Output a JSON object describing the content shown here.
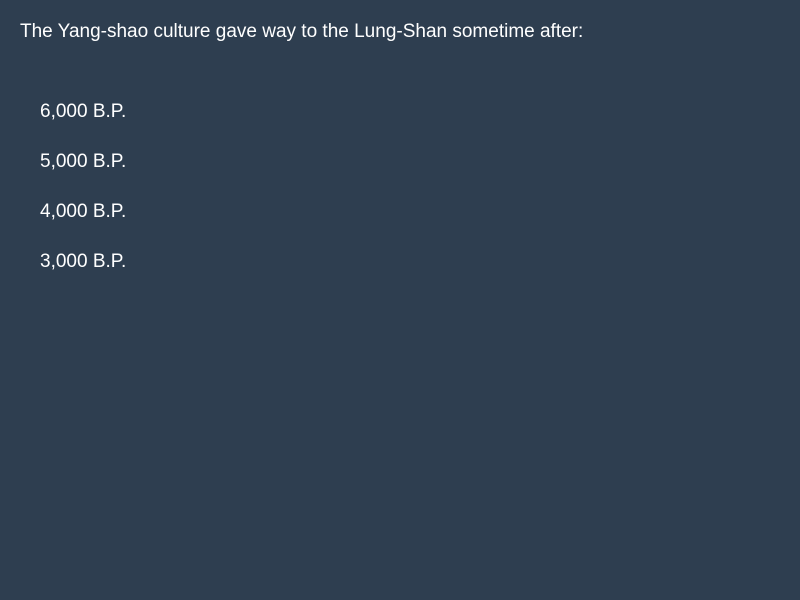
{
  "question": {
    "text": "The Yang-shao culture gave way to the Lung-Shan sometime after:"
  },
  "options": [
    {
      "label": "6,000 B.P."
    },
    {
      "label": "5,000 B.P."
    },
    {
      "label": "4,000 B.P."
    },
    {
      "label": "3,000 B.P."
    }
  ],
  "colors": {
    "background": "#2e3e50",
    "text": "#ffffff"
  }
}
